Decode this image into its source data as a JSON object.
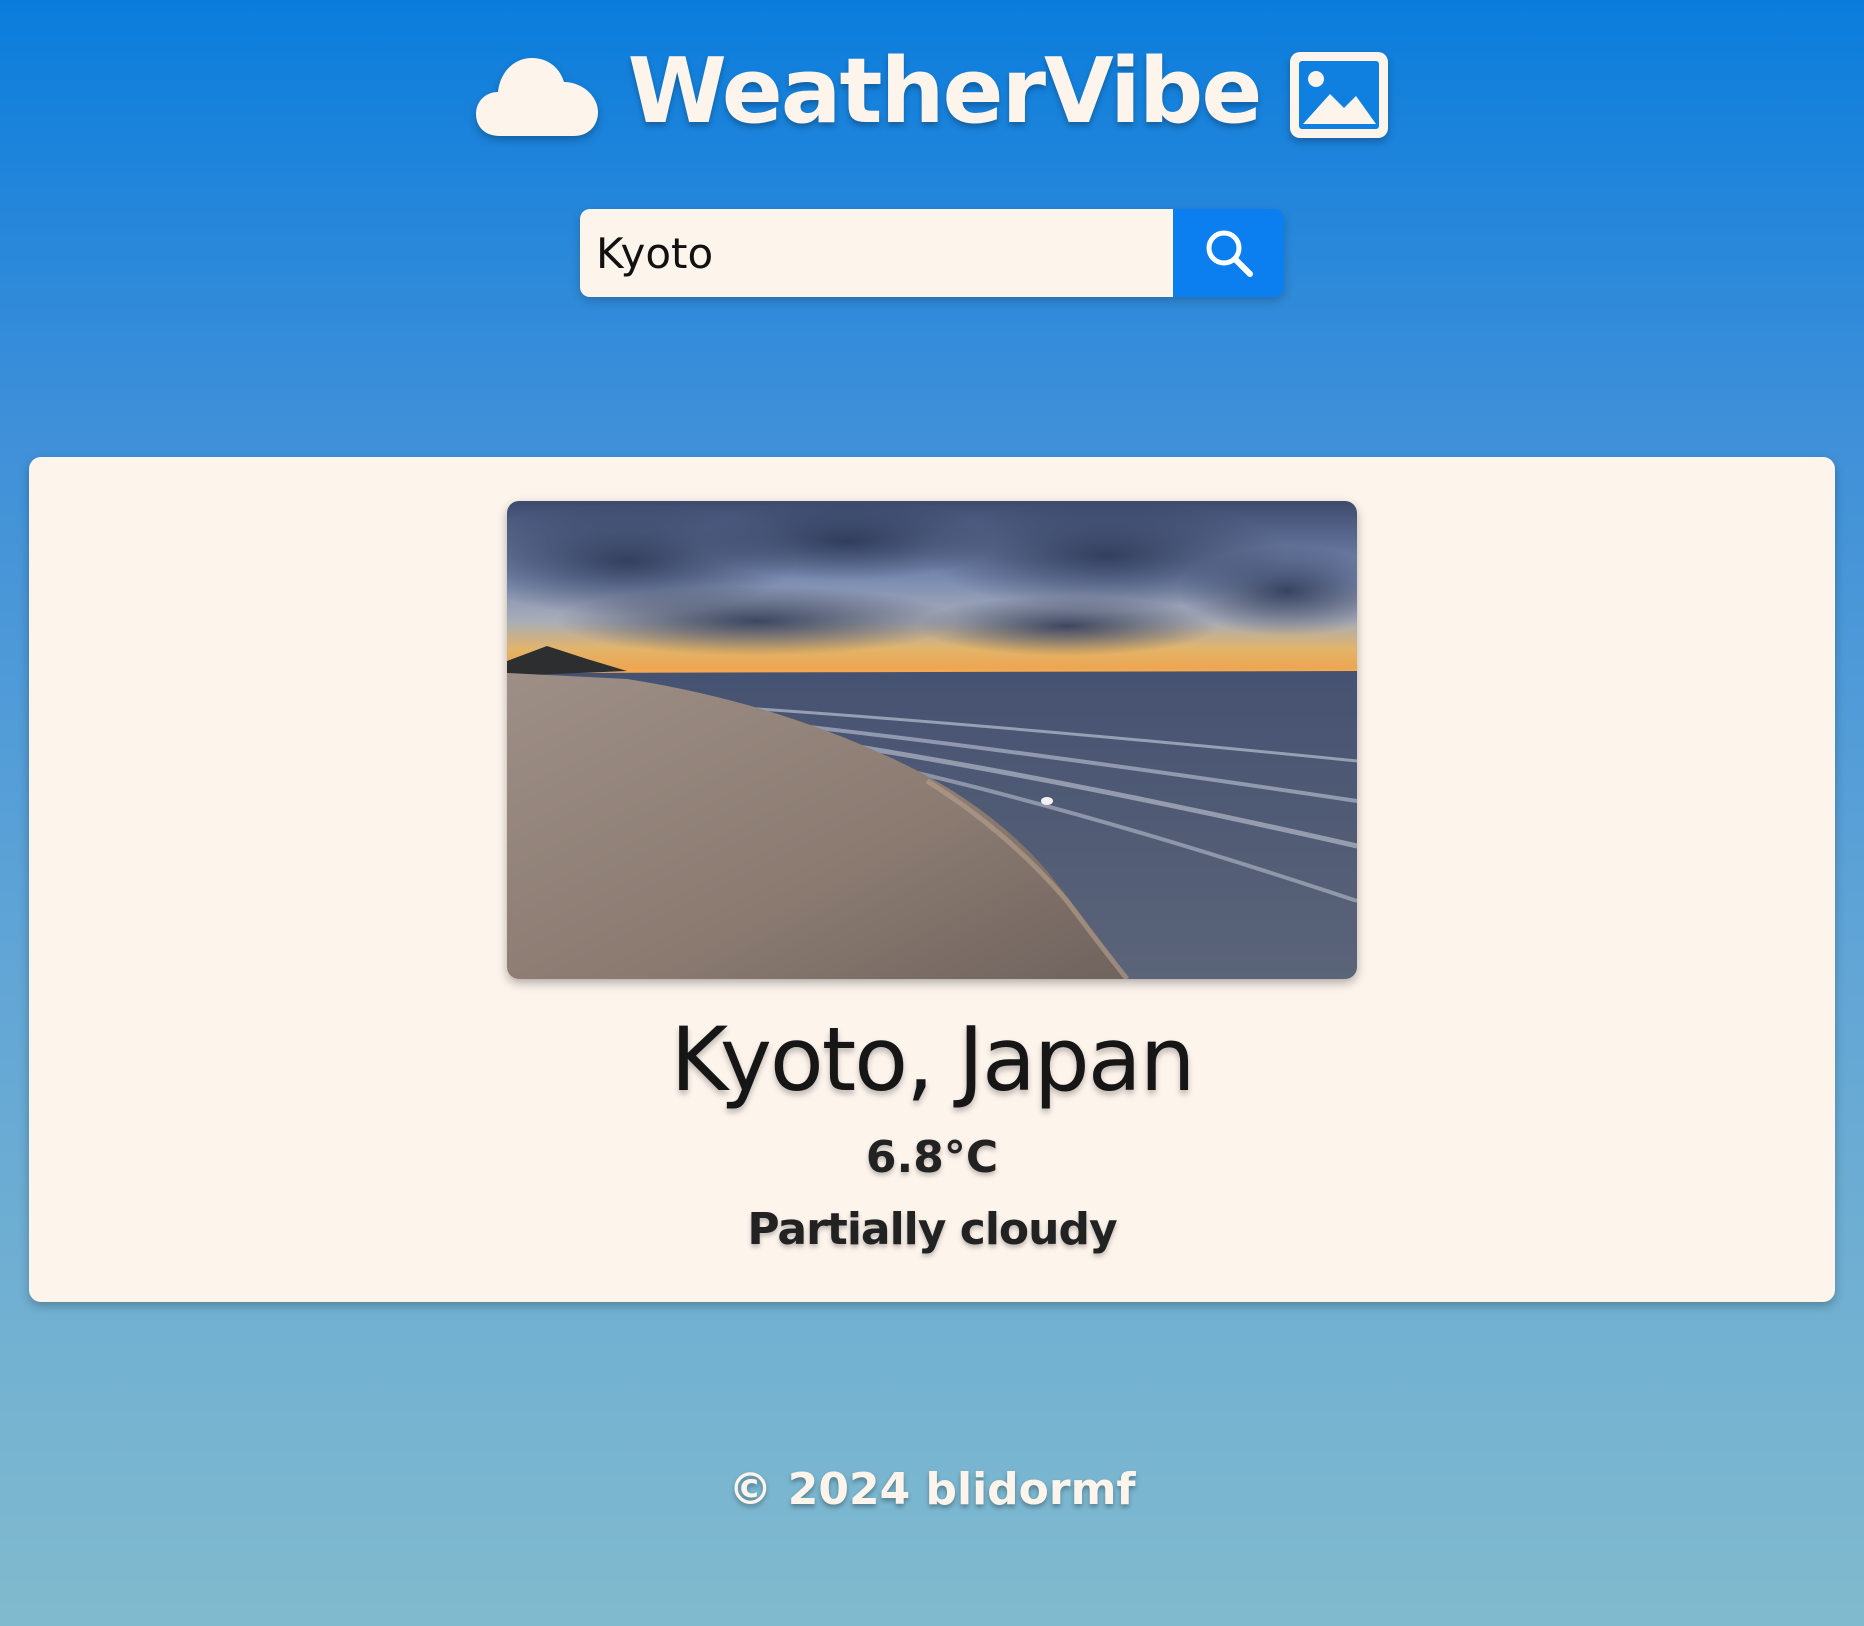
{
  "header": {
    "title": "WeatherVibe",
    "left_icon": "cloud-icon",
    "right_icon": "image-icon"
  },
  "search": {
    "value": "Kyoto",
    "button_icon": "search-icon"
  },
  "weather": {
    "location": "Kyoto, Japan",
    "temperature": "6.8°C",
    "condition": "Partially cloudy",
    "photo_subject": "beach at sunset under cloudy sky"
  },
  "footer": {
    "copyright": "© 2024 blidormf"
  },
  "colors": {
    "accent": "#0b7ff0",
    "card_background": "#fdf4ec",
    "header_text": "#fdf4ec"
  }
}
